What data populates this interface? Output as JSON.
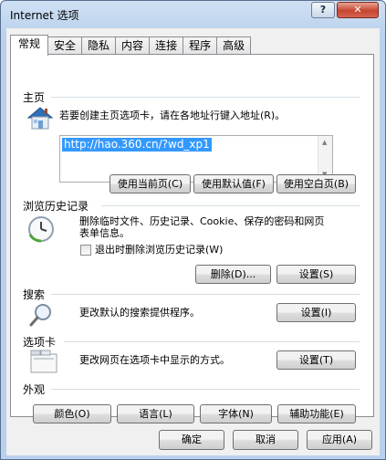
{
  "window": {
    "title": "Internet 选项",
    "help_glyph": "?",
    "close_glyph": "✕"
  },
  "tabs": [
    "常规",
    "安全",
    "隐私",
    "内容",
    "连接",
    "程序",
    "高级"
  ],
  "homepage": {
    "heading": "主页",
    "description": "若要创建主页选项卡，请在各地址行键入地址(R)。",
    "url": "http://hao.360.cn/?wd_xp1",
    "btn_current": "使用当前页(C)",
    "btn_default": "使用默认值(F)",
    "btn_blank": "使用空白页(B)"
  },
  "history": {
    "heading": "浏览历史记录",
    "description_line1": "删除临时文件、历史记录、Cookie、保存的密码和网页",
    "description_line2": "表单信息。",
    "checkbox_label": "退出时删除浏览历史记录(W)",
    "checkbox_checked": false,
    "btn_delete": "删除(D)...",
    "btn_settings": "设置(S)"
  },
  "search": {
    "heading": "搜索",
    "description": "更改默认的搜索提供程序。",
    "btn_settings": "设置(I)"
  },
  "tabs_section": {
    "heading": "选项卡",
    "description": "更改网页在选项卡中显示的方式。",
    "btn_settings": "设置(T)"
  },
  "appearance": {
    "heading": "外观",
    "btn_colors": "颜色(O)",
    "btn_languages": "语言(L)",
    "btn_fonts": "字体(N)",
    "btn_accessibility": "辅助功能(E)"
  },
  "footer": {
    "ok": "确定",
    "cancel": "取消",
    "apply": "应用(A)"
  },
  "colors": {
    "selection": "#3399ff",
    "titlebar": "#b9d1ec",
    "close": "#c7442f"
  }
}
